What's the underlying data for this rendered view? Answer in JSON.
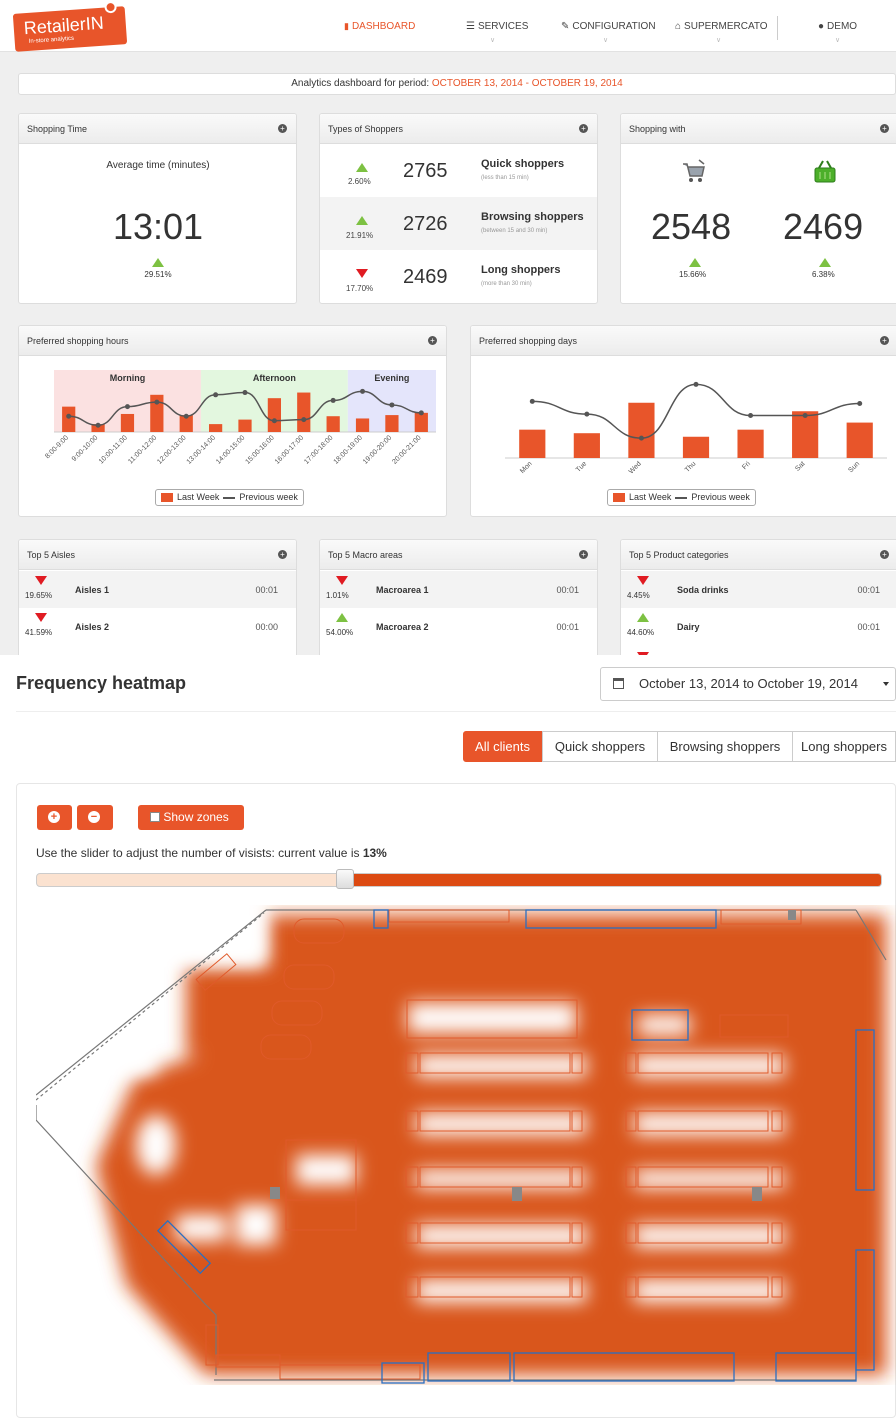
{
  "logo": {
    "name": "RetailerIN",
    "tagline": "In-store analytics"
  },
  "nav": {
    "dashboard": "DASHBOARD",
    "services": "SERVICES",
    "configuration": "CONFIGURATION",
    "supermercato": "SUPERMERCATO",
    "user": "DEMO"
  },
  "period": {
    "prefix": "Analytics dashboard for period:",
    "range": "OCTOBER 13, 2014 - OCTOBER 19, 2014"
  },
  "shopping_time": {
    "title": "Shopping Time",
    "label": "Average time (minutes)",
    "value": "13:01",
    "change": "29.51%",
    "trend": "up"
  },
  "types": {
    "title": "Types of Shoppers",
    "rows": [
      {
        "change": "2.60%",
        "trend": "up",
        "value": "2765",
        "name": "Quick shoppers",
        "sub": "(less than 15 min)"
      },
      {
        "change": "21.91%",
        "trend": "up",
        "value": "2726",
        "name": "Browsing shoppers",
        "sub": "(between 15 and 30 min)"
      },
      {
        "change": "17.70%",
        "trend": "down",
        "value": "2469",
        "name": "Long shoppers",
        "sub": "(more than 30 min)"
      }
    ]
  },
  "shopping_with": {
    "title": "Shopping with",
    "items": [
      {
        "icon": "cart-icon",
        "value": "2548",
        "change": "15.66%",
        "trend": "up"
      },
      {
        "icon": "basket-icon",
        "value": "2469",
        "change": "6.38%",
        "trend": "up"
      }
    ]
  },
  "hours": {
    "title": "Preferred shopping hours",
    "zones": [
      "Morning",
      "Afternoon",
      "Evening"
    ],
    "legend_bar": "Last Week",
    "legend_line": "Previous week"
  },
  "days": {
    "title": "Preferred shopping days",
    "legend_bar": "Last Week",
    "legend_line": "Previous week"
  },
  "chart_data": [
    {
      "type": "bar",
      "categories": [
        "8:00-9:00",
        "9:00-10:00",
        "10:00-11:00",
        "11:00-12:00",
        "12:00-13:00",
        "13:00-14:00",
        "14:00-15:00",
        "15:00-16:00",
        "16:00-17:00",
        "17:00-18:00",
        "18:00-19:00",
        "19:00-20:00",
        "20:00-21:00"
      ],
      "series": [
        {
          "name": "Last Week",
          "type": "bar",
          "values": [
            45,
            14,
            32,
            66,
            30,
            14,
            22,
            60,
            70,
            28,
            24,
            30,
            34
          ]
        },
        {
          "name": "Previous week",
          "type": "line",
          "values": [
            28,
            12,
            45,
            53,
            28,
            66,
            70,
            20,
            22,
            56,
            72,
            48,
            34
          ]
        }
      ],
      "bands": [
        {
          "label": "Morning",
          "from": 0,
          "to": 4
        },
        {
          "label": "Afternoon",
          "from": 5,
          "to": 9
        },
        {
          "label": "Evening",
          "from": 10,
          "to": 12
        }
      ],
      "ylim": [
        0,
        110
      ],
      "legend": "bottom"
    },
    {
      "type": "bar",
      "categories": [
        "Mon",
        "Tue",
        "Wed",
        "Thu",
        "Fri",
        "Sat",
        "Sun"
      ],
      "series": [
        {
          "name": "Last Week",
          "type": "bar",
          "values": [
            40,
            35,
            78,
            30,
            40,
            66,
            50
          ]
        },
        {
          "name": "Previous week",
          "type": "line",
          "values": [
            80,
            62,
            28,
            104,
            60,
            60,
            77
          ]
        }
      ],
      "ylim": [
        0,
        120
      ],
      "legend": "bottom"
    }
  ],
  "aisles": {
    "title": "Top 5 Aisles",
    "rows": [
      {
        "change": "19.65%",
        "trend": "down",
        "name": "Aisles 1",
        "time": "00:01"
      },
      {
        "change": "41.59%",
        "trend": "down",
        "name": "Aisles 2",
        "time": "00:00"
      }
    ]
  },
  "macro": {
    "title": "Top 5 Macro areas",
    "rows": [
      {
        "change": "1.01%",
        "trend": "down",
        "name": "Macroarea 1",
        "time": "00:01"
      },
      {
        "change": "54.00%",
        "trend": "up",
        "name": "Macroarea 2",
        "time": "00:01"
      }
    ]
  },
  "categories": {
    "title": "Top 5 Product categories",
    "rows": [
      {
        "change": "4.45%",
        "trend": "down",
        "name": "Soda drinks",
        "time": "00:01"
      },
      {
        "change": "44.60%",
        "trend": "up",
        "name": "Dairy",
        "time": "00:01"
      }
    ]
  },
  "heatmap": {
    "title": "Frequency heatmap",
    "date_range": "October 13, 2014 to October 19, 2014",
    "filters": [
      "All clients",
      "Quick shoppers",
      "Browsing shoppers",
      "Long shoppers"
    ],
    "active_filter": "All clients",
    "show_zones": "Show zones",
    "slider_text": "Use the slider to adjust the number of visists: current value is",
    "slider_value": "13%",
    "slider_fraction": 0.13
  }
}
